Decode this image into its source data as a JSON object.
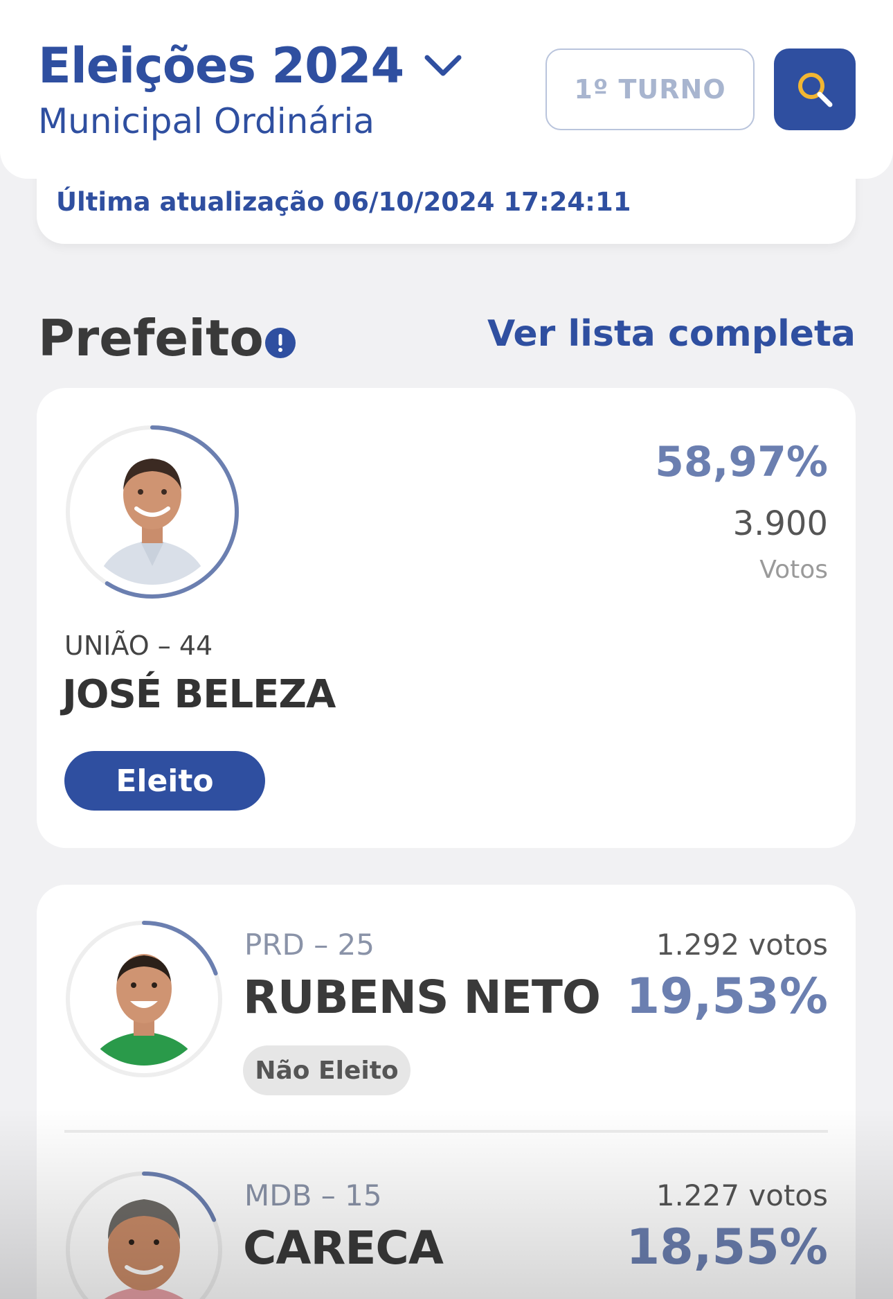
{
  "header": {
    "title": "Eleições 2024",
    "subtitle": "Municipal Ordinária",
    "turno_label": "1º TURNO",
    "search_icon": "search-icon"
  },
  "update": {
    "text": "Última atualização 06/10/2024 17:24:11"
  },
  "section": {
    "title": "Prefeito",
    "link": "Ver lista completa"
  },
  "candidates": [
    {
      "party": "UNIÃO – 44",
      "name": "JOSÉ BELEZA",
      "percent": "58,97%",
      "percent_value": 58.97,
      "votes": "3.900",
      "votes_label": "Votos",
      "status": "Eleito"
    },
    {
      "party": "PRD – 25",
      "name": "RUBENS NETO",
      "percent": "19,53%",
      "percent_value": 19.53,
      "votes": "1.292 votos",
      "status": "Não Eleito"
    },
    {
      "party": "MDB – 15",
      "name": "CARECA",
      "percent": "18,55%",
      "percent_value": 18.55,
      "votes": "1.227 votos"
    }
  ],
  "colors": {
    "brand": "#2f4fa0",
    "accent_search": "#f2b632",
    "percent": "#6b7fb0",
    "ring": "#6b7fb0"
  }
}
